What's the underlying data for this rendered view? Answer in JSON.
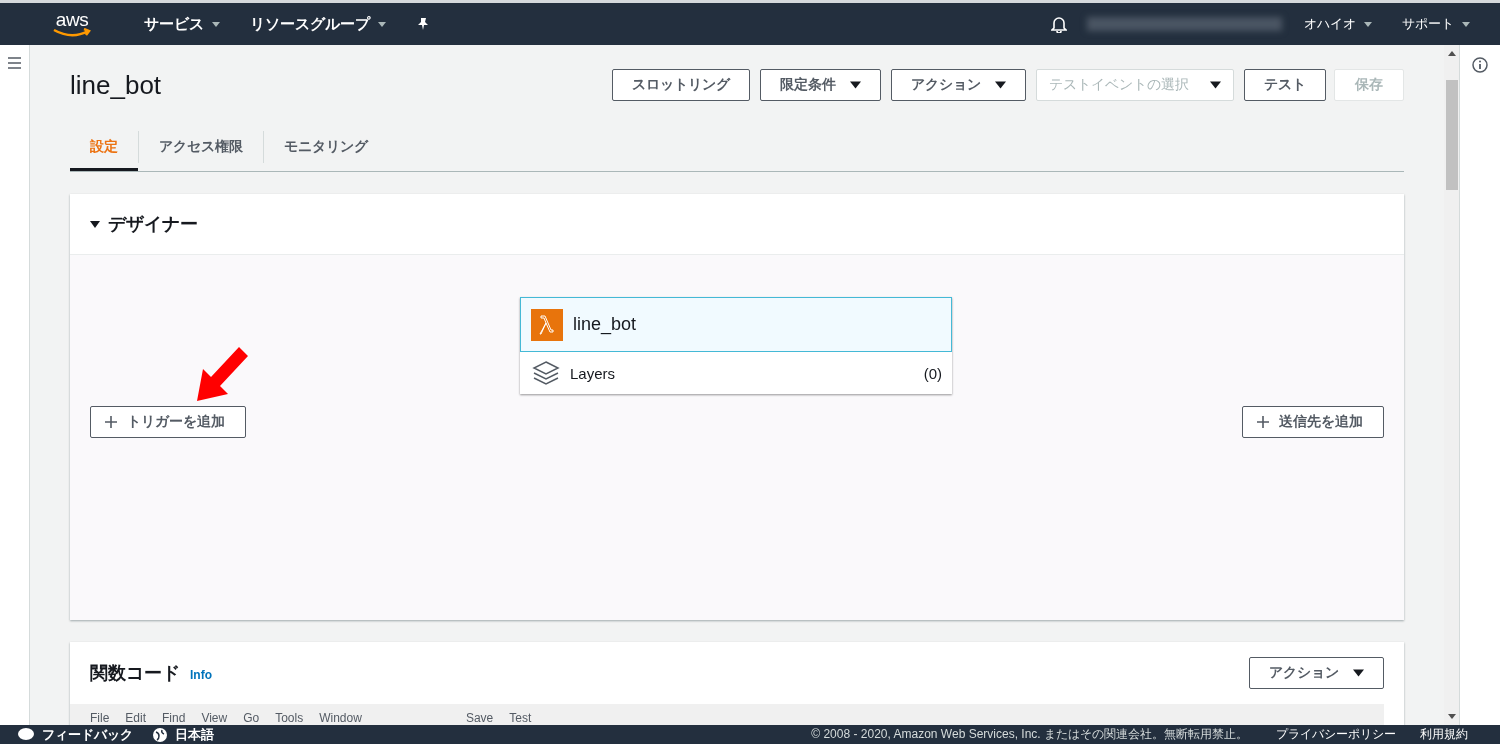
{
  "header": {
    "logo": "aws",
    "menus": [
      {
        "label": "サービス",
        "dropdown": true
      },
      {
        "label": "リソースグループ",
        "dropdown": true
      }
    ],
    "region": {
      "label": "オハイオ",
      "dropdown": true
    },
    "support": {
      "label": "サポート",
      "dropdown": true
    }
  },
  "function_name": "line_bot",
  "actions": [
    {
      "kind": "button",
      "label": "スロットリング",
      "disabled": false
    },
    {
      "kind": "dropdown",
      "label": "限定条件",
      "disabled": false
    },
    {
      "kind": "dropdown",
      "label": "アクション",
      "disabled": false
    },
    {
      "kind": "select",
      "placeholder": "テストイベントの選択",
      "disabled": false
    },
    {
      "kind": "button",
      "label": "テスト",
      "disabled": false
    },
    {
      "kind": "button",
      "label": "保存",
      "disabled": true
    }
  ],
  "tabs": [
    {
      "label": "設定",
      "selected": true
    },
    {
      "label": "アクセス権限",
      "selected": false
    },
    {
      "label": "モニタリング",
      "selected": false
    }
  ],
  "designer": {
    "title": "デザイナー",
    "expanded": true,
    "function": {
      "name": "line_bot",
      "layers_label": "Layers",
      "layers_count": "(0)"
    },
    "add_trigger": "トリガーを追加",
    "add_destination": "送信先を追加"
  },
  "function_code": {
    "title": "関数コード",
    "info_link": "Info",
    "action_button": "アクション",
    "editor_menu": [
      "File",
      "Edit",
      "Find",
      "View",
      "Go",
      "Tools",
      "Window"
    ],
    "editor_actions": [
      "Save",
      "Test"
    ]
  },
  "footer": {
    "feedback": "フィードバック",
    "language": "日本語",
    "copyright": "© 2008 - 2020, Amazon Web Services, Inc. またはその関連会社。無断転用禁止。",
    "links": [
      "プライバシーポリシー",
      "利用規約"
    ]
  }
}
